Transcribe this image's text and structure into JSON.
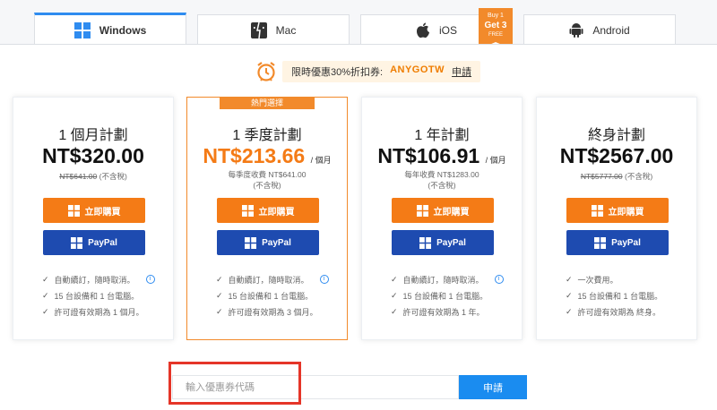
{
  "tabs": [
    {
      "label": "Windows",
      "icon": "windows-icon"
    },
    {
      "label": "Mac",
      "icon": "finder-icon"
    },
    {
      "label": "iOS",
      "icon": "apple-icon"
    },
    {
      "label": "Android",
      "icon": "android-icon"
    }
  ],
  "badge": {
    "line1": "Buy 1",
    "line2": "Get 3",
    "line3": "FREE"
  },
  "promo": {
    "text": "限時優惠30%折扣券:",
    "code": "ANYGOTW",
    "apply": "申請"
  },
  "plans": [
    {
      "name": "1 個月計劃",
      "price": "NT$320.00",
      "per": "",
      "original": "NT$641.00",
      "tax": "(不含稅)",
      "subtotal": "",
      "buy_label": "立即購買",
      "paypal_label": "PayPal",
      "features": [
        "自動續訂，隨時取消。",
        "15 台設備和 1 台電腦。",
        "許可證有效期為 1 個月。"
      ]
    },
    {
      "hot": "熱門選擇",
      "name": "1 季度計劃",
      "price": "NT$213.66",
      "per": "/ 個月",
      "subtotal": "每季度收費 NT$641.00",
      "tax": "(不含稅)",
      "buy_label": "立即購買",
      "paypal_label": "PayPal",
      "features": [
        "自動續訂，隨時取消。",
        "15 台設備和 1 台電腦。",
        "許可證有效期為 3 個月。"
      ]
    },
    {
      "name": "1 年計劃",
      "price": "NT$106.91",
      "per": "/ 個月",
      "subtotal": "每年收費 NT$1283.00",
      "tax": "(不含稅)",
      "buy_label": "立即購買",
      "paypal_label": "PayPal",
      "features": [
        "自動續訂，隨時取消。",
        "15 台設備和 1 台電腦。",
        "許可證有效期為 1 年。"
      ]
    },
    {
      "name": "終身計劃",
      "price": "NT$2567.00",
      "per": "",
      "original": "NT$5777.00",
      "tax": "(不含稅)",
      "buy_label": "立即購買",
      "paypal_label": "PayPal",
      "features": [
        "一次費用。",
        "15 台設備和 1 台電腦。",
        "許可證有效期為 終身。"
      ]
    }
  ],
  "coupon": {
    "placeholder": "輸入優惠券代碼",
    "button": "申請"
  },
  "colors": {
    "accent": "#f47b16",
    "paypal": "#1e4bb0",
    "link_blue": "#1a8cf0",
    "highlight": "#e53528"
  }
}
